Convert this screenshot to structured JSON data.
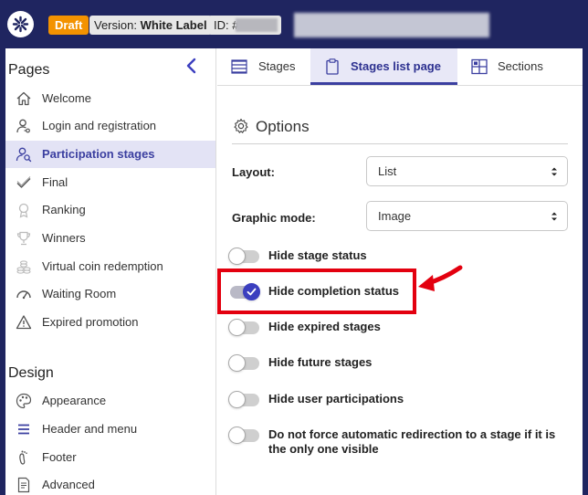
{
  "topbar": {
    "status_badge": "Draft",
    "version_label": "Version:",
    "version_value": "White Label",
    "id_label": "ID: #"
  },
  "sidebar": {
    "pages_heading": "Pages",
    "design_heading": "Design",
    "pages": [
      {
        "label": "Welcome",
        "icon": "home-icon"
      },
      {
        "label": "Login and registration",
        "icon": "user-key-icon"
      },
      {
        "label": "Participation stages",
        "icon": "user-search-icon",
        "active": true
      },
      {
        "label": "Final",
        "icon": "check-icon"
      },
      {
        "label": "Ranking",
        "icon": "medal-icon"
      },
      {
        "label": "Winners",
        "icon": "trophy-icon"
      },
      {
        "label": "Virtual coin redemption",
        "icon": "coins-icon"
      },
      {
        "label": "Waiting Room",
        "icon": "speedometer-icon"
      },
      {
        "label": "Expired promotion",
        "icon": "warning-icon"
      }
    ],
    "design": [
      {
        "label": "Appearance",
        "icon": "palette-icon"
      },
      {
        "label": "Header and menu",
        "icon": "menu-icon"
      },
      {
        "label": "Footer",
        "icon": "footprint-icon"
      },
      {
        "label": "Advanced",
        "icon": "code-file-icon"
      }
    ]
  },
  "tabs": [
    {
      "label": "Stages",
      "icon": "list-icon"
    },
    {
      "label": "Stages list page",
      "icon": "clipboard-icon",
      "active": true
    },
    {
      "label": "Sections",
      "icon": "grid-icon"
    }
  ],
  "options": {
    "title": "Options",
    "layout_label": "Layout:",
    "layout_value": "List",
    "graphic_label": "Graphic mode:",
    "graphic_value": "Image",
    "toggles": [
      {
        "label": "Hide stage status",
        "on": false
      },
      {
        "label": "Hide completion status",
        "on": true
      },
      {
        "label": "Hide expired stages",
        "on": false
      },
      {
        "label": "Hide future stages",
        "on": false
      },
      {
        "label": "Hide user participations",
        "on": false
      },
      {
        "label": "Do not force automatic redirection to a stage if it is the only one visible",
        "on": false
      }
    ]
  },
  "colors": {
    "topbar": "#1f2560",
    "accent": "#3b3fa0",
    "draft": "#f39200",
    "highlight": "#e3000f"
  }
}
